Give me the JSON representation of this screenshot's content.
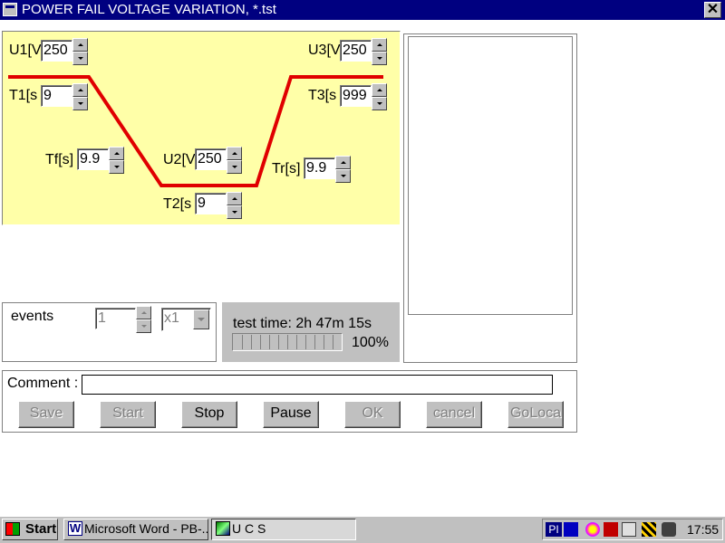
{
  "window": {
    "title": "POWER FAIL VOLTAGE VARIATION, *.tst",
    "close_glyph": "✕"
  },
  "params": {
    "u1": {
      "label": "U1[V",
      "value": "250"
    },
    "t1": {
      "label": "T1[s",
      "value": "9"
    },
    "tf": {
      "label": "Tf[s]",
      "value": "9.9"
    },
    "u2": {
      "label": "U2[V",
      "value": "250"
    },
    "t2": {
      "label": "T2[s",
      "value": "9"
    },
    "tr": {
      "label": "Tr[s]",
      "value": "9.9"
    },
    "u3": {
      "label": "U3[V",
      "value": "250"
    },
    "t3": {
      "label": "T3[s",
      "value": "999"
    }
  },
  "waveform": {
    "color": "#e00000",
    "background": "#ffffa8"
  },
  "events": {
    "label": "events",
    "count": "1",
    "multiplier": "x1"
  },
  "progress": {
    "test_time": "test time: 2h 47m 15s",
    "percent_text": "100%",
    "percent": 100
  },
  "comment": {
    "label": "Comment :",
    "value": ""
  },
  "buttons": {
    "save": "Save",
    "start": "Start",
    "stop": "Stop",
    "pause": "Pause",
    "ok": "OK",
    "cancel": "cancel",
    "golocal": "GoLoca"
  },
  "taskbar": {
    "start": "Start",
    "tasks": [
      "Microsoft Word - PB-...",
      "U C S"
    ],
    "tray_text": [
      "PI"
    ],
    "clock": "17:55"
  }
}
